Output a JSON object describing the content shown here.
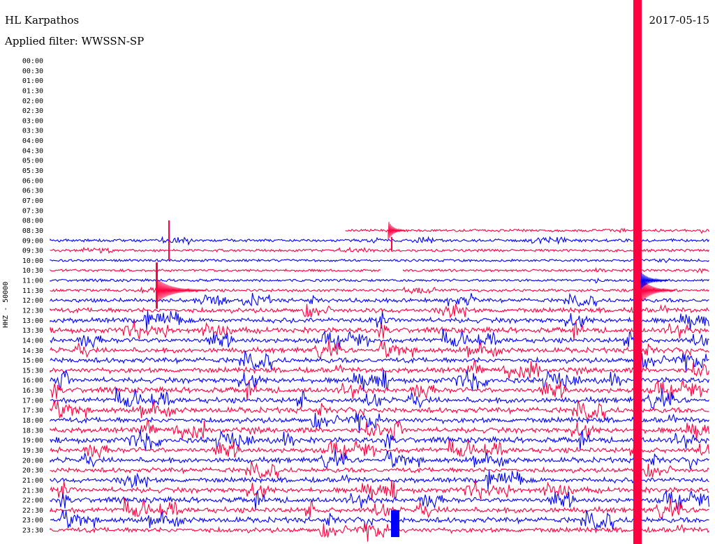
{
  "header": {
    "station": "HL Karpathos",
    "filter": "Applied filter: WWSSN-SP",
    "date": "2017-05-15"
  },
  "chart_data": {
    "type": "line",
    "ylabel": "HHZ - 50000",
    "row_labels": [
      "00:00",
      "00:30",
      "01:00",
      "01:30",
      "02:00",
      "02:30",
      "03:00",
      "03:30",
      "04:00",
      "04:30",
      "05:00",
      "05:30",
      "06:00",
      "06:30",
      "07:00",
      "07:30",
      "08:00",
      "08:30",
      "09:00",
      "09:30",
      "10:00",
      "10:30",
      "11:00",
      "11:30",
      "12:00",
      "12:30",
      "13:00",
      "13:30",
      "14:00",
      "14:30",
      "15:00",
      "15:30",
      "16:00",
      "16:30",
      "17:00",
      "17:30",
      "18:00",
      "18:30",
      "19:00",
      "19:30",
      "20:00",
      "20:30",
      "21:00",
      "21:30",
      "22:00",
      "22:30",
      "23:00",
      "23:30"
    ],
    "first_row_with_data": "08:30",
    "series_colors": [
      "#0000ff",
      "#ff0040"
    ],
    "activity_by_row": [
      0,
      0,
      0,
      0,
      0,
      0,
      0,
      0,
      0,
      0,
      0,
      0,
      0,
      0,
      0,
      0,
      0,
      0.25,
      0.3,
      0.25,
      0.2,
      0.2,
      0.25,
      0.3,
      0.6,
      0.85,
      0.9,
      0.95,
      0.9,
      0.9,
      0.95,
      0.95,
      1,
      1,
      1,
      1,
      1,
      1,
      1,
      0.95,
      0.9,
      0.85,
      0.9,
      0.95,
      0.95,
      1,
      1,
      0.9
    ]
  }
}
